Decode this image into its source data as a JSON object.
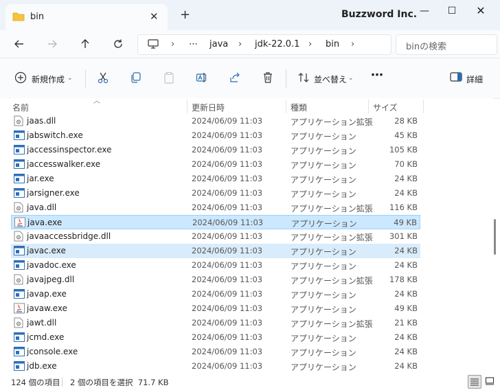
{
  "window": {
    "tab_title": "bin",
    "company": "Buzzword Inc."
  },
  "address": {
    "more": "⋯",
    "parts": [
      "java",
      "jdk-22.0.1",
      "bin"
    ]
  },
  "search": {
    "placeholder": "binの検索"
  },
  "toolbar": {
    "new_label": "新規作成",
    "sort_label": "並べ替え",
    "details_label": "詳細"
  },
  "columns": {
    "name": "名前",
    "date": "更新日時",
    "type": "種類",
    "size": "サイズ"
  },
  "files": [
    {
      "name": "jaas.dll",
      "date": "2024/06/09 11:03",
      "type": "アプリケーション拡張",
      "size": "28 KB",
      "icon": "dll-icon"
    },
    {
      "name": "jabswitch.exe",
      "date": "2024/06/09 11:03",
      "type": "アプリケーション",
      "size": "45 KB",
      "icon": "exe-icon"
    },
    {
      "name": "jaccessinspector.exe",
      "date": "2024/06/09 11:03",
      "type": "アプリケーション",
      "size": "105 KB",
      "icon": "exe-icon"
    },
    {
      "name": "jaccesswalker.exe",
      "date": "2024/06/09 11:03",
      "type": "アプリケーション",
      "size": "70 KB",
      "icon": "exe-icon"
    },
    {
      "name": "jar.exe",
      "date": "2024/06/09 11:03",
      "type": "アプリケーション",
      "size": "24 KB",
      "icon": "exe-icon"
    },
    {
      "name": "jarsigner.exe",
      "date": "2024/06/09 11:03",
      "type": "アプリケーション",
      "size": "24 KB",
      "icon": "exe-icon"
    },
    {
      "name": "java.dll",
      "date": "2024/06/09 11:03",
      "type": "アプリケーション拡張",
      "size": "116 KB",
      "icon": "dll-icon"
    },
    {
      "name": "java.exe",
      "date": "2024/06/09 11:03",
      "type": "アプリケーション",
      "size": "49 KB",
      "icon": "java-exe-icon",
      "state": "selected"
    },
    {
      "name": "javaaccessbridge.dll",
      "date": "2024/06/09 11:03",
      "type": "アプリケーション拡張",
      "size": "301 KB",
      "icon": "dll-icon"
    },
    {
      "name": "javac.exe",
      "date": "2024/06/09 11:03",
      "type": "アプリケーション",
      "size": "24 KB",
      "icon": "exe-icon",
      "state": "selected-light"
    },
    {
      "name": "javadoc.exe",
      "date": "2024/06/09 11:03",
      "type": "アプリケーション",
      "size": "24 KB",
      "icon": "exe-icon"
    },
    {
      "name": "javajpeg.dll",
      "date": "2024/06/09 11:03",
      "type": "アプリケーション拡張",
      "size": "178 KB",
      "icon": "dll-icon"
    },
    {
      "name": "javap.exe",
      "date": "2024/06/09 11:03",
      "type": "アプリケーション",
      "size": "24 KB",
      "icon": "exe-icon"
    },
    {
      "name": "javaw.exe",
      "date": "2024/06/09 11:03",
      "type": "アプリケーション",
      "size": "49 KB",
      "icon": "java-exe-icon"
    },
    {
      "name": "jawt.dll",
      "date": "2024/06/09 11:03",
      "type": "アプリケーション拡張",
      "size": "21 KB",
      "icon": "dll-icon"
    },
    {
      "name": "jcmd.exe",
      "date": "2024/06/09 11:03",
      "type": "アプリケーション",
      "size": "24 KB",
      "icon": "exe-icon"
    },
    {
      "name": "jconsole.exe",
      "date": "2024/06/09 11:03",
      "type": "アプリケーション",
      "size": "24 KB",
      "icon": "exe-icon"
    },
    {
      "name": "jdb.exe",
      "date": "2024/06/09 11:03",
      "type": "アプリケーション",
      "size": "24 KB",
      "icon": "exe-icon"
    }
  ],
  "status": {
    "item_count": "124 個の項目",
    "selection": "2 個の項目を選択  71.7 KB"
  },
  "colors": {
    "selected_bg": "#cce8ff",
    "selected_border": "#99d1ff",
    "selected_light_bg": "#d9ecfb",
    "titlebar_bg": "#eef3fa",
    "folder_yellow": "#f8c33c",
    "exe_blue": "#2d6fb8"
  }
}
